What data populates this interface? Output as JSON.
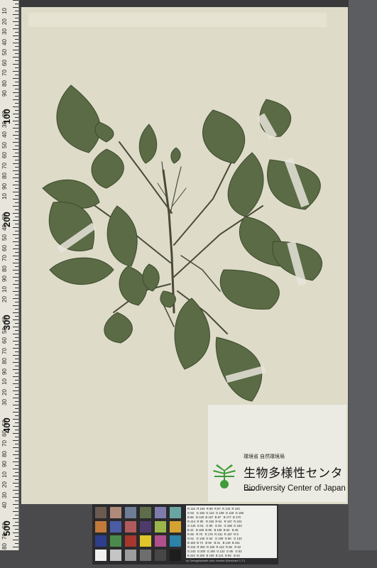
{
  "ruler": {
    "small_numbers": [
      "10",
      "20",
      "30",
      "40",
      "50",
      "60",
      "70",
      "80",
      "90",
      "10",
      "20",
      "30",
      "40",
      "50",
      "60",
      "70",
      "80",
      "90",
      "10",
      "20",
      "30",
      "40",
      "50",
      "60",
      "70",
      "80",
      "90",
      "10",
      "20",
      "30",
      "40",
      "50",
      "60",
      "70",
      "80",
      "90",
      "10",
      "20",
      "30",
      "40",
      "50",
      "60",
      "70",
      "80",
      "90",
      "10",
      "20",
      "30",
      "40",
      "50",
      "60",
      "70",
      "80",
      "90"
    ],
    "big_numbers": [
      "100",
      "200",
      "300",
      "400",
      "500"
    ]
  },
  "label": {
    "ministry_text": "環境省 自然環境局",
    "center_name_jp": "生物多様性センター",
    "center_name_en": "Biodiversity Center of Japan"
  },
  "color_chart": {
    "swatches": [
      "#6a5a4f",
      "#b08a78",
      "#6f7d96",
      "#5e6e4a",
      "#7e7cab",
      "#69a6a3",
      "#c27a3a",
      "#4b5ca5",
      "#b15a5e",
      "#4f3b6b",
      "#9cb54a",
      "#d4a22f",
      "#2d3f8b",
      "#4b8a4c",
      "#a8362f",
      "#e1c52a",
      "#b0508c",
      "#2c82a8",
      "#f0f0f0",
      "#c5c5c5",
      "#9c9c9c",
      "#6e6e6e",
      "#464646",
      "#1e1e1e"
    ],
    "values_rows": [
      "R 115  R 194  R 98  R 87  R 133  R 103",
      "G 82   G 150  G 122  G 108  G 128  G 189",
      "B 68   B 130  B 157  B 67   B 177  B 170",
      "R 214  R 80   R 193  R 94   R 157  R 224",
      "G 126  G 91   G 90   G 60   G 188  G 163",
      "B 44   B 166  B 99   B 108  B 64   B 46",
      "R 56   R 70   R 175  R 231  R 187  R 8",
      "G 61   G 148  G 54   G 199  G 86   G 133",
      "B 150  B 73   B 60   B 31   B 149  B 161",
      "R 243  R 200  R 160  R 122  R 85   R 52",
      "G 243  G 200  G 160  G 122  G 85   G 52",
      "B 242  B 200  B 160  B 121  B 85   B 52"
    ],
    "footer": "by GretagMacbeth color checker (Illuminant C 2°)"
  }
}
